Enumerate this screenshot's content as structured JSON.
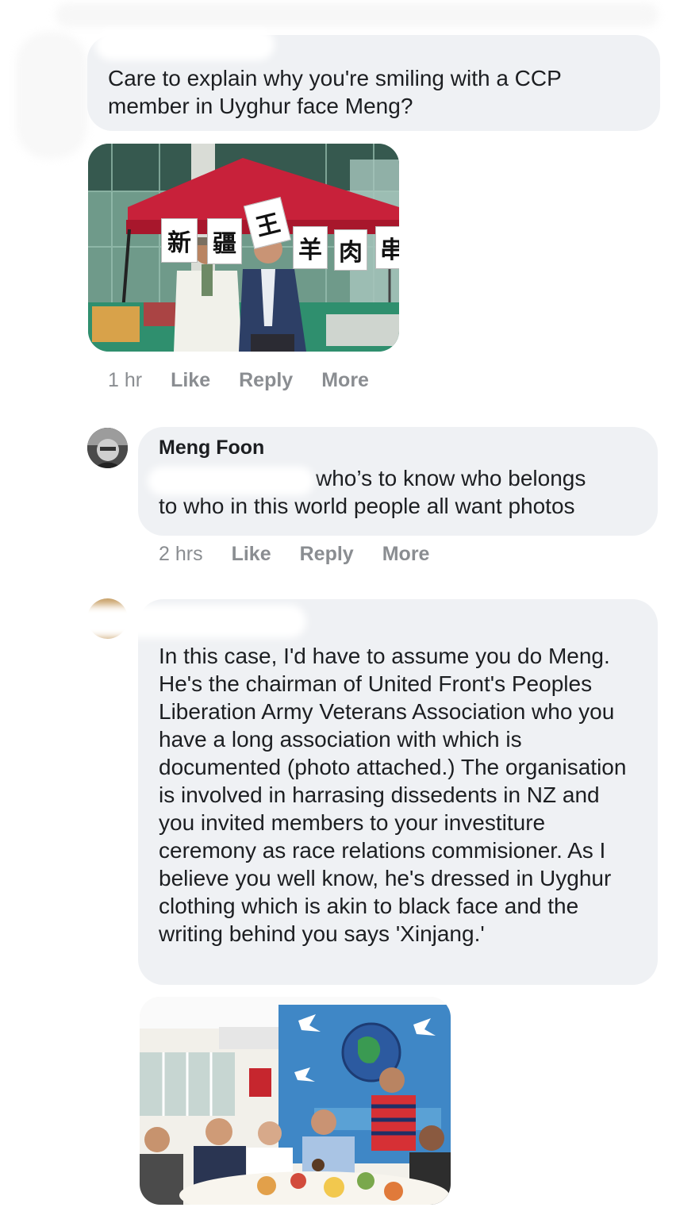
{
  "comment1": {
    "text": "Care to explain why you're smiling with a CCP member in Uyghur face Meng?",
    "meta": {
      "time": "1 hr",
      "like": "Like",
      "reply": "Reply",
      "more": "More"
    },
    "photo": {
      "signs": [
        "新",
        "疆",
        "王",
        "羊",
        "肉",
        "串"
      ]
    }
  },
  "comment2": {
    "author": "Meng Foon",
    "text_line1": "who’s to know who belongs",
    "text_line2": "to who in this world people all want photos",
    "meta": {
      "time": "2 hrs",
      "like": "Like",
      "reply": "Reply",
      "more": "More"
    }
  },
  "comment3": {
    "text": "In this case, I'd have to assume you do Meng. He's the chairman of United Front's Peoples Liberation Army Veterans Association who you have a long association with which is documented (photo attached.) The organisation is involved in harrasing dissedents in NZ and you invited members to your investiture ceremony as race relations commisioner. As I believe you well know, he's dressed in Uyghur clothing which is akin to black face and the writing behind you says 'Xinjang.'"
  },
  "colors": {
    "bubble": "#eff1f4",
    "meta_gray": "#8a8d91",
    "text": "#1c1e21"
  }
}
